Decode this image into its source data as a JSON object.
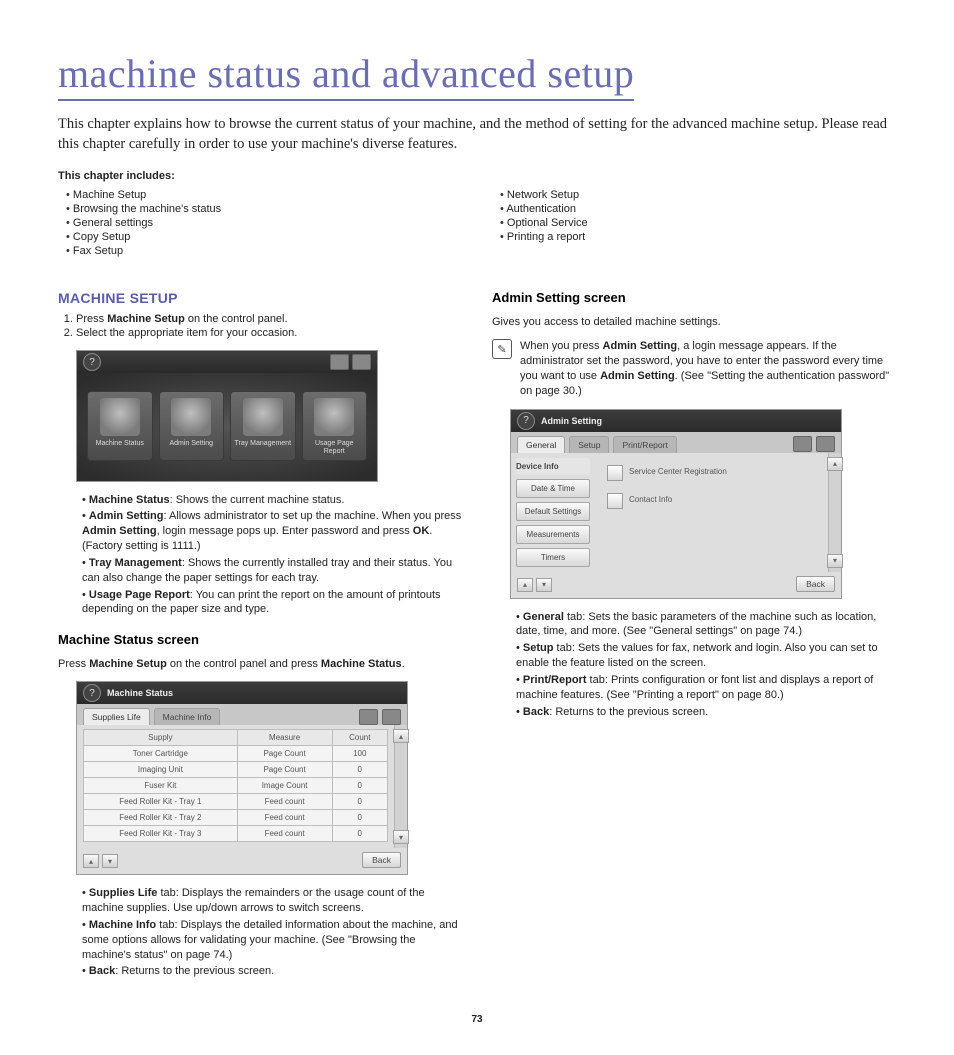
{
  "title": "machine status and advanced setup",
  "intro": "This chapter explains how to browse the current status of your machine, and the method of setting for the advanced machine setup. Please read this chapter carefully in order to use your machine's diverse features.",
  "includes_heading": "This chapter includes:",
  "toc_left": [
    "Machine Setup",
    "Browsing the machine's status",
    "General settings",
    "Copy Setup",
    "Fax Setup"
  ],
  "toc_right": [
    "Network Setup",
    "Authentication",
    "Optional Service",
    "Printing a report"
  ],
  "machine_setup": {
    "heading": "MACHINE SETUP",
    "steps": [
      "Press <b>Machine Setup</b> on the control panel.",
      "Select the appropriate item for your occasion."
    ],
    "tiles": [
      "Machine Status",
      "Admin Setting",
      "Tray Management",
      "Usage Page Report"
    ],
    "bullets": [
      "<b>Machine Status</b>: Shows the current machine status.",
      "<b>Admin Setting</b>: Allows administrator to set up the machine. When you press <b>Admin Setting</b>, login message pops up. Enter password and press <b>OK</b>. (Factory setting is 1111.)",
      "<b>Tray Management</b>: Shows the currently installed tray and their status. You can also change the paper settings for each tray.",
      "<b>Usage Page Report</b>: You can print the report on the amount of printouts depending on the paper size and type."
    ]
  },
  "status_screen": {
    "heading": "Machine Status screen",
    "lead": "Press <b>Machine Setup</b> on the control panel and press <b>Machine Status</b>.",
    "shot_title": "Machine Status",
    "tabs": [
      "Supplies Life",
      "Machine Info"
    ],
    "columns": [
      "Supply",
      "Measure",
      "Count"
    ],
    "rows": [
      [
        "Toner Cartridge",
        "Page Count",
        "100"
      ],
      [
        "Imaging Unit",
        "Page Count",
        "0"
      ],
      [
        "Fuser Kit",
        "Image Count",
        "0"
      ],
      [
        "Feed Roller Kit - Tray 1",
        "Feed count",
        "0"
      ],
      [
        "Feed Roller Kit - Tray 2",
        "Feed count",
        "0"
      ],
      [
        "Feed Roller Kit - Tray 3",
        "Feed count",
        "0"
      ]
    ],
    "back": "Back",
    "bullets": [
      "<b>Supplies Life</b> tab: Displays the remainders or the usage count of the machine supplies. Use up/down arrows to switch screens.",
      "<b>Machine Info</b> tab: Displays the detailed information about the machine, and some options allows for validating your machine. (See \"Browsing the machine's status\" on page 74.)",
      "<b>Back</b>: Returns to the previous screen."
    ]
  },
  "admin_screen": {
    "heading": "Admin Setting screen",
    "lead": "Gives you access to detailed machine settings.",
    "note": "When you press <b>Admin Setting</b>, a login message appears. If the administrator set the password, you have to enter the password every time you want to use <b>Admin Setting</b>. (See \"Setting the authentication password\" on page 30.)",
    "shot_title": "Admin Setting",
    "tabs": [
      "General",
      "Setup",
      "Print/Report"
    ],
    "side_header": "Device Info",
    "side": [
      "Date & Time",
      "Default Settings",
      "Measurements",
      "Timers"
    ],
    "checks": [
      "Service Center Registration",
      "Contact Info"
    ],
    "back": "Back",
    "bullets": [
      "<b>General</b> tab: Sets the basic parameters of the machine such as location, date, time, and more. (See \"General settings\" on page 74.)",
      "<b>Setup</b> tab: Sets the values for fax, network and login. Also you can set to enable the feature listed on the screen.",
      "<b>Print/Report</b> tab: Prints configuration or font list and displays a report of machine features. (See \"Printing a report\" on page 80.)",
      "<b>Back</b>: Returns to the previous screen."
    ]
  },
  "page_number": "73"
}
